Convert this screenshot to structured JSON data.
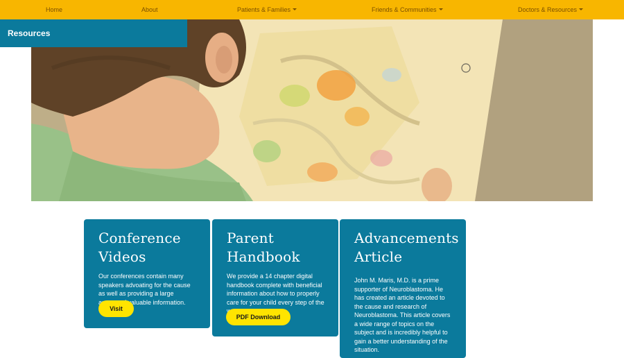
{
  "nav": {
    "home": "Home",
    "about": "About",
    "patients": "Patients & Families",
    "friends": "Friends & Communities",
    "doctors": "Doctors & Resources"
  },
  "colors": {
    "nav_bg": "#f8b600",
    "accent": "#0b7a9c",
    "button": "#ffe400"
  },
  "hero": {
    "label": "Resources"
  },
  "cards": [
    {
      "title": "Conference Videos",
      "text": "Our conferences contain many speakers advoating for the cause as well as providing a large amount of valuable information.",
      "button": "Visit"
    },
    {
      "title": "Parent Handbook",
      "text": "We provide a 14 chapter digital handbook complete with beneficial information about how to properly care for your child every step of the way.",
      "button": "PDF Download"
    },
    {
      "title_line1": "Advancements",
      "title_line2": "Article",
      "text": "John M. Maris, M.D. is a prime supporter of Neuroblastoma. He has created an article devoted to the cause and research of Neuroblastoma. This article covers a wide range of topics on the subject and is incredibly helpful to gain a better understanding of the situation."
    }
  ]
}
